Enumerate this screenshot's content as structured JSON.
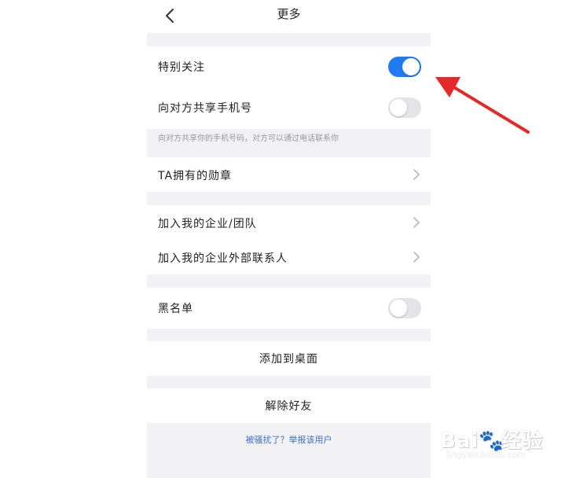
{
  "header": {
    "title": "更多"
  },
  "settings": {
    "special_follow": {
      "label": "特别关注",
      "enabled": true
    },
    "share_phone": {
      "label": "向对方共享手机号",
      "enabled": false
    },
    "share_phone_hint": "向对方共享你的手机号码，对方可以通过电话联系你",
    "badges": {
      "label": "TA拥有的勋章"
    },
    "join_team": {
      "label": "加入我的企业/团队"
    },
    "join_external": {
      "label": "加入我的企业外部联系人"
    },
    "blacklist": {
      "label": "黑名单",
      "enabled": false
    }
  },
  "actions": {
    "add_to_desktop": "添加到桌面",
    "remove_friend": "解除好友",
    "report": "被骚扰了？举报该用户"
  },
  "colors": {
    "toggle_on": "#1e7bf2",
    "toggle_off": "#e4e4e6",
    "link": "#3a6fc6",
    "arrow": "#e32a2a"
  },
  "watermark": {
    "brand": "Bai",
    "brand_tail": "经验",
    "domain": "jingyan.baidu.com"
  }
}
